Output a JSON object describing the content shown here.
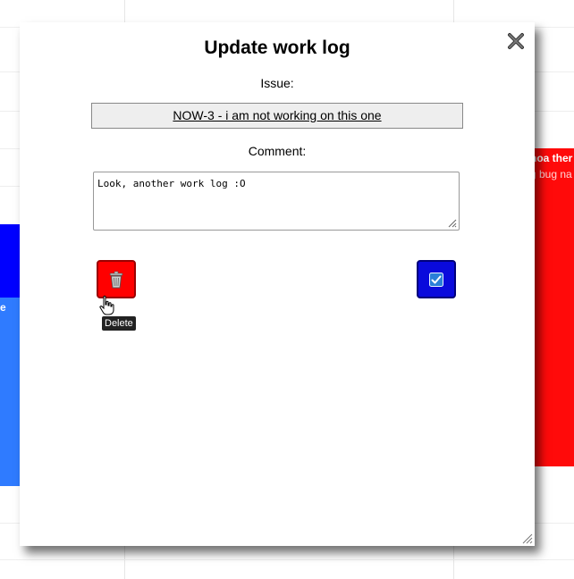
{
  "modal": {
    "title": "Update work log",
    "issue_label": "Issue:",
    "issue_link": "NOW-3 - i am not working on this one",
    "comment_label": "Comment:",
    "comment_value": "Look, another work log :O",
    "close_icon": "close-icon",
    "delete_button": {
      "icon": "trash-icon",
      "tooltip": "Delete"
    },
    "save_button": {
      "icon": "checkbox-check-icon"
    }
  },
  "background": {
    "left_event_text": "e",
    "right_event_title": "noa ther",
    "right_event_sub": "g bug na"
  },
  "colors": {
    "delete": "#ff0000",
    "save": "#0a0adc",
    "event_blue": "#0000ff",
    "event_light_blue": "#2f7bff",
    "event_red": "#ff0a0a"
  }
}
